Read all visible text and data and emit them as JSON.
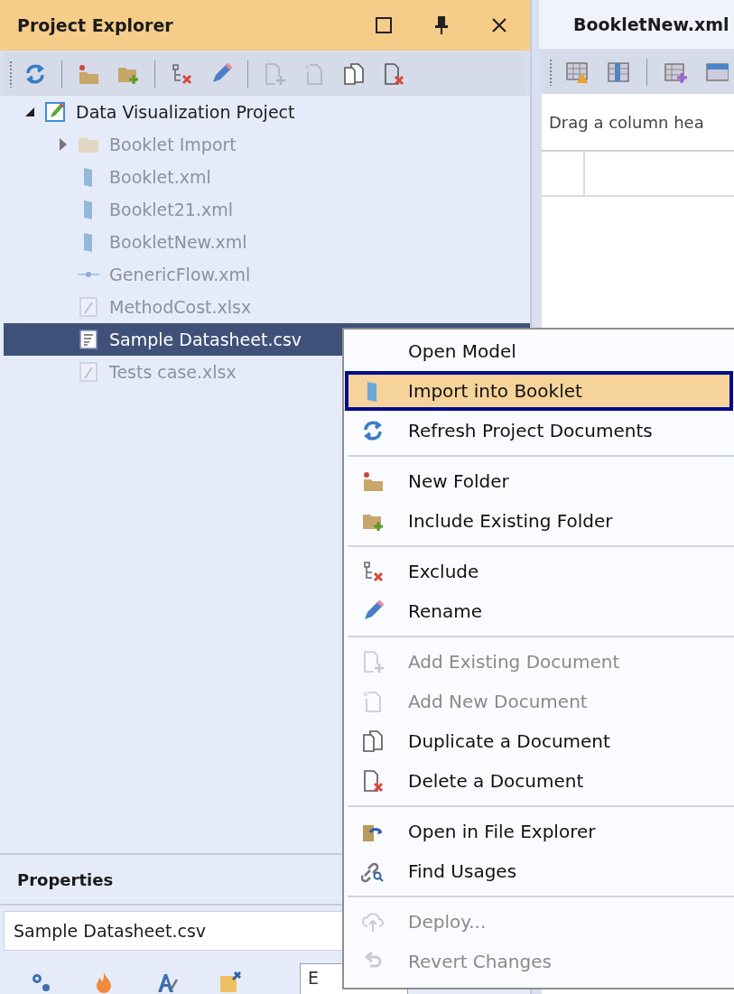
{
  "explorer": {
    "title": "Project Explorer",
    "toolbar": [
      [
        {
          "disabled": false
        }
      ],
      [
        {
          "disabled": false
        },
        {
          "disabled": false
        }
      ],
      [
        {
          "disabled": false
        },
        {
          "disabled": false
        }
      ],
      [
        {
          "disabled": true
        },
        {
          "disabled": true
        },
        {
          "disabled": false
        },
        {
          "disabled": false
        }
      ]
    ],
    "tree": {
      "label": "Data Visualization Project",
      "kind": "project",
      "expanded": true,
      "selected": false,
      "dimmed": false,
      "children": [
        {
          "label": "Booklet Import",
          "kind": "folder",
          "expanded": false,
          "selected": false,
          "dimmed": true
        },
        {
          "label": "Booklet.xml",
          "kind": "booklet",
          "selected": false,
          "dimmed": true
        },
        {
          "label": "Booklet21.xml",
          "kind": "booklet",
          "selected": false,
          "dimmed": true
        },
        {
          "label": "BookletNew.xml",
          "kind": "booklet",
          "selected": false,
          "dimmed": true
        },
        {
          "label": "GenericFlow.xml",
          "kind": "flow",
          "selected": false,
          "dimmed": true
        },
        {
          "label": "MethodCost.xlsx",
          "kind": "sheet",
          "selected": false,
          "dimmed": true
        },
        {
          "label": "Sample Datasheet.csv",
          "kind": "csv",
          "selected": true,
          "dimmed": false
        },
        {
          "label": "Tests case.xlsx",
          "kind": "sheet",
          "selected": false,
          "dimmed": true
        }
      ]
    }
  },
  "properties": {
    "title": "Properties",
    "object": "Sample Datasheet.csv",
    "search_value": "E"
  },
  "document": {
    "tab": "BookletNew.xml",
    "group_hint": "Drag a column hea"
  },
  "context_menu": [
    [
      {
        "label": "Open Model",
        "disabled": false,
        "selected": false
      },
      {
        "label": "Import into Booklet",
        "disabled": false,
        "selected": true
      },
      {
        "label": "Refresh Project Documents",
        "disabled": false,
        "selected": false
      }
    ],
    [
      {
        "label": "New Folder",
        "disabled": false,
        "selected": false
      },
      {
        "label": "Include Existing Folder",
        "disabled": false,
        "selected": false
      }
    ],
    [
      {
        "label": "Exclude",
        "disabled": false,
        "selected": false
      },
      {
        "label": "Rename",
        "disabled": false,
        "selected": false
      }
    ],
    [
      {
        "label": "Add Existing Document",
        "disabled": true,
        "selected": false
      },
      {
        "label": "Add New Document",
        "disabled": true,
        "selected": false
      },
      {
        "label": "Duplicate a Document",
        "disabled": false,
        "selected": false
      },
      {
        "label": "Delete a Document",
        "disabled": false,
        "selected": false
      }
    ],
    [
      {
        "label": "Open in File Explorer",
        "disabled": false,
        "selected": false
      },
      {
        "label": "Find Usages",
        "disabled": false,
        "selected": false
      }
    ],
    [
      {
        "label": "Deploy...",
        "disabled": true,
        "selected": false
      },
      {
        "label": "Revert Changes",
        "disabled": true,
        "selected": false
      }
    ]
  ]
}
